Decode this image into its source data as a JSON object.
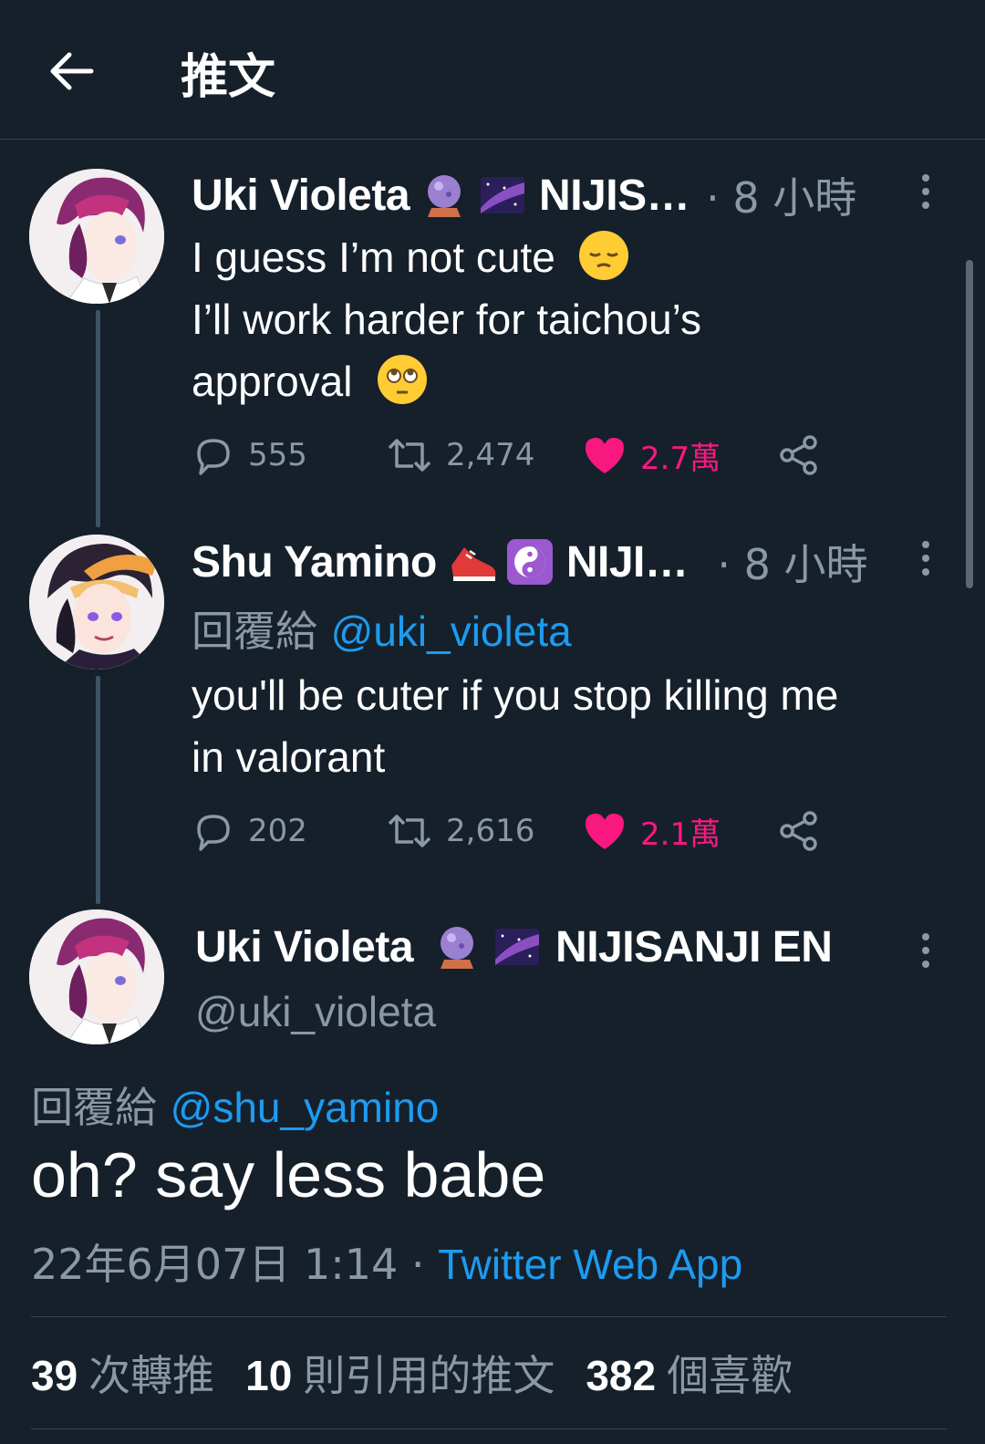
{
  "header": {
    "title": "推文"
  },
  "tweets": [
    {
      "name": "Uki Violeta",
      "affiliation": "NIJIS…",
      "time": "· 8 小時",
      "emojis": [
        "crystal-ball-icon",
        "milky-way-icon"
      ],
      "text_lines": [
        "I guess I’m not cute",
        "I’ll work harder for taichou’s",
        "approval"
      ],
      "replies": "555",
      "retweets": "2,474",
      "likes": "2.7萬"
    },
    {
      "name": "Shu Yamino",
      "affiliation": "NIJI…",
      "time": "· 8 小時",
      "emojis": [
        "running-shoe-icon",
        "yin-yang-icon"
      ],
      "reply_prefix": "回覆給",
      "reply_mention": "@uki_violeta",
      "text_lines": [
        "you'll be cuter if you stop killing me",
        "in valorant"
      ],
      "replies": "202",
      "retweets": "2,616",
      "likes": "2.1萬"
    }
  ],
  "main_tweet": {
    "name": "Uki Violeta",
    "affiliation": "NIJISANJI EN",
    "handle": "@uki_violeta",
    "reply_prefix": "回覆給",
    "reply_mention": "@shu_yamino",
    "text": "oh? say less babe",
    "date": "22年6月07日 1:14 ·",
    "source": "Twitter Web App",
    "stats": {
      "retweets": "39",
      "retweets_label": "次轉推",
      "quotes": "10",
      "quotes_label": "則引用的推文",
      "likes": "382",
      "likes_label": "個喜歡"
    }
  },
  "colors": {
    "background": "#15202b",
    "accent": "#1d9bf0",
    "like": "#f91880",
    "muted": "#8b98a5"
  }
}
